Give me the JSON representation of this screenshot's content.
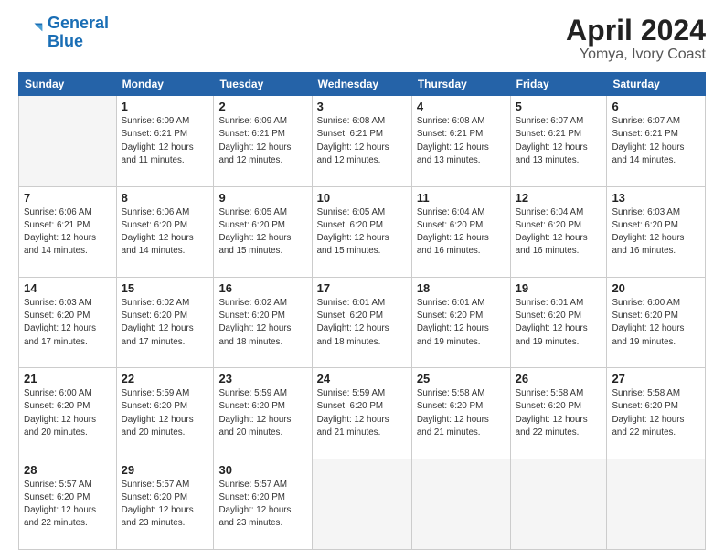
{
  "logo": {
    "line1": "General",
    "line2": "Blue"
  },
  "title": "April 2024",
  "subtitle": "Yomya, Ivory Coast",
  "weekdays": [
    "Sunday",
    "Monday",
    "Tuesday",
    "Wednesday",
    "Thursday",
    "Friday",
    "Saturday"
  ],
  "weeks": [
    [
      {
        "day": "",
        "info": ""
      },
      {
        "day": "1",
        "info": "Sunrise: 6:09 AM\nSunset: 6:21 PM\nDaylight: 12 hours\nand 11 minutes."
      },
      {
        "day": "2",
        "info": "Sunrise: 6:09 AM\nSunset: 6:21 PM\nDaylight: 12 hours\nand 12 minutes."
      },
      {
        "day": "3",
        "info": "Sunrise: 6:08 AM\nSunset: 6:21 PM\nDaylight: 12 hours\nand 12 minutes."
      },
      {
        "day": "4",
        "info": "Sunrise: 6:08 AM\nSunset: 6:21 PM\nDaylight: 12 hours\nand 13 minutes."
      },
      {
        "day": "5",
        "info": "Sunrise: 6:07 AM\nSunset: 6:21 PM\nDaylight: 12 hours\nand 13 minutes."
      },
      {
        "day": "6",
        "info": "Sunrise: 6:07 AM\nSunset: 6:21 PM\nDaylight: 12 hours\nand 14 minutes."
      }
    ],
    [
      {
        "day": "7",
        "info": "Sunrise: 6:06 AM\nSunset: 6:21 PM\nDaylight: 12 hours\nand 14 minutes."
      },
      {
        "day": "8",
        "info": "Sunrise: 6:06 AM\nSunset: 6:20 PM\nDaylight: 12 hours\nand 14 minutes."
      },
      {
        "day": "9",
        "info": "Sunrise: 6:05 AM\nSunset: 6:20 PM\nDaylight: 12 hours\nand 15 minutes."
      },
      {
        "day": "10",
        "info": "Sunrise: 6:05 AM\nSunset: 6:20 PM\nDaylight: 12 hours\nand 15 minutes."
      },
      {
        "day": "11",
        "info": "Sunrise: 6:04 AM\nSunset: 6:20 PM\nDaylight: 12 hours\nand 16 minutes."
      },
      {
        "day": "12",
        "info": "Sunrise: 6:04 AM\nSunset: 6:20 PM\nDaylight: 12 hours\nand 16 minutes."
      },
      {
        "day": "13",
        "info": "Sunrise: 6:03 AM\nSunset: 6:20 PM\nDaylight: 12 hours\nand 16 minutes."
      }
    ],
    [
      {
        "day": "14",
        "info": "Sunrise: 6:03 AM\nSunset: 6:20 PM\nDaylight: 12 hours\nand 17 minutes."
      },
      {
        "day": "15",
        "info": "Sunrise: 6:02 AM\nSunset: 6:20 PM\nDaylight: 12 hours\nand 17 minutes."
      },
      {
        "day": "16",
        "info": "Sunrise: 6:02 AM\nSunset: 6:20 PM\nDaylight: 12 hours\nand 18 minutes."
      },
      {
        "day": "17",
        "info": "Sunrise: 6:01 AM\nSunset: 6:20 PM\nDaylight: 12 hours\nand 18 minutes."
      },
      {
        "day": "18",
        "info": "Sunrise: 6:01 AM\nSunset: 6:20 PM\nDaylight: 12 hours\nand 19 minutes."
      },
      {
        "day": "19",
        "info": "Sunrise: 6:01 AM\nSunset: 6:20 PM\nDaylight: 12 hours\nand 19 minutes."
      },
      {
        "day": "20",
        "info": "Sunrise: 6:00 AM\nSunset: 6:20 PM\nDaylight: 12 hours\nand 19 minutes."
      }
    ],
    [
      {
        "day": "21",
        "info": "Sunrise: 6:00 AM\nSunset: 6:20 PM\nDaylight: 12 hours\nand 20 minutes."
      },
      {
        "day": "22",
        "info": "Sunrise: 5:59 AM\nSunset: 6:20 PM\nDaylight: 12 hours\nand 20 minutes."
      },
      {
        "day": "23",
        "info": "Sunrise: 5:59 AM\nSunset: 6:20 PM\nDaylight: 12 hours\nand 20 minutes."
      },
      {
        "day": "24",
        "info": "Sunrise: 5:59 AM\nSunset: 6:20 PM\nDaylight: 12 hours\nand 21 minutes."
      },
      {
        "day": "25",
        "info": "Sunrise: 5:58 AM\nSunset: 6:20 PM\nDaylight: 12 hours\nand 21 minutes."
      },
      {
        "day": "26",
        "info": "Sunrise: 5:58 AM\nSunset: 6:20 PM\nDaylight: 12 hours\nand 22 minutes."
      },
      {
        "day": "27",
        "info": "Sunrise: 5:58 AM\nSunset: 6:20 PM\nDaylight: 12 hours\nand 22 minutes."
      }
    ],
    [
      {
        "day": "28",
        "info": "Sunrise: 5:57 AM\nSunset: 6:20 PM\nDaylight: 12 hours\nand 22 minutes."
      },
      {
        "day": "29",
        "info": "Sunrise: 5:57 AM\nSunset: 6:20 PM\nDaylight: 12 hours\nand 23 minutes."
      },
      {
        "day": "30",
        "info": "Sunrise: 5:57 AM\nSunset: 6:20 PM\nDaylight: 12 hours\nand 23 minutes."
      },
      {
        "day": "",
        "info": ""
      },
      {
        "day": "",
        "info": ""
      },
      {
        "day": "",
        "info": ""
      },
      {
        "day": "",
        "info": ""
      }
    ]
  ]
}
